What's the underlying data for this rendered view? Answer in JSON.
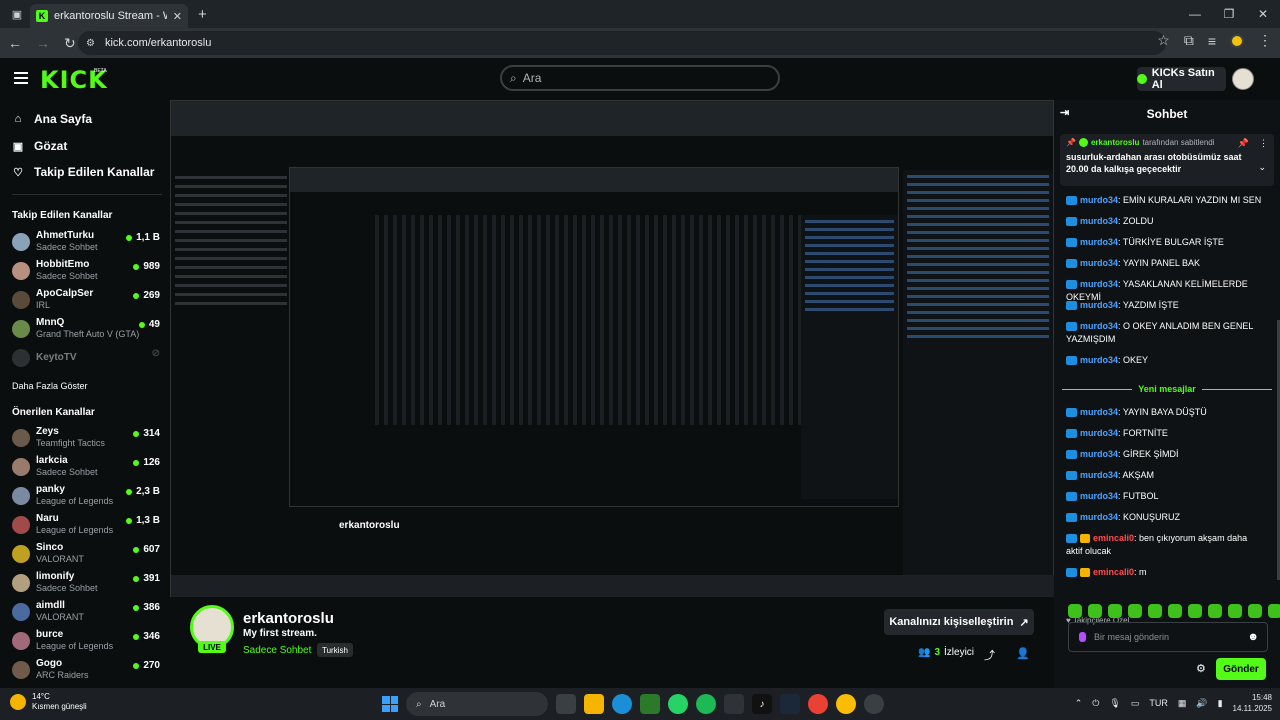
{
  "browser": {
    "tab_title": "erkantoroslu Stream - Watch Liv",
    "url": "kick.com/erkantoroslu"
  },
  "header": {
    "logo": "KICK",
    "beta": "BETA",
    "search_placeholder": "Ara",
    "buy_label": "KICKs Satın Al"
  },
  "sidebar": {
    "nav": [
      {
        "label": "Ana Sayfa",
        "icon": "home-icon"
      },
      {
        "label": "Gözat",
        "icon": "browse-icon"
      },
      {
        "label": "Takip Edilen Kanallar",
        "icon": "heart-icon"
      }
    ],
    "followed_heading": "Takip Edilen Kanallar",
    "followed": [
      {
        "name": "AhmetTurku",
        "category": "Sadece Sohbet",
        "viewers": "1,1 B",
        "color": "#8aa2b8"
      },
      {
        "name": "HobbitEmo",
        "category": "Sadece Sohbet",
        "viewers": "989",
        "color": "#b89080"
      },
      {
        "name": "ApoCalpSer",
        "category": "IRL",
        "viewers": "269",
        "color": "#5a4a3a"
      },
      {
        "name": "MnnQ",
        "category": "Grand Theft Auto V (GTA)",
        "viewers": "49",
        "color": "#6a8a4a"
      },
      {
        "name": "KeytoTV",
        "category": "",
        "viewers": "",
        "color": "#555a60"
      }
    ],
    "show_more": "Daha Fazla Göster",
    "recommended_heading": "Önerilen Kanallar",
    "recommended": [
      {
        "name": "Zeys",
        "category": "Teamfight Tactics",
        "viewers": "314",
        "color": "#6a5a4a"
      },
      {
        "name": "larkcia",
        "category": "Sadece Sohbet",
        "viewers": "126",
        "color": "#9a7a6a"
      },
      {
        "name": "panky",
        "category": "League of Legends",
        "viewers": "2,3 B",
        "color": "#7a8aa0"
      },
      {
        "name": "Naru",
        "category": "League of Legends",
        "viewers": "1,3 B",
        "color": "#a04a4a"
      },
      {
        "name": "Sinco",
        "category": "VALORANT",
        "viewers": "607",
        "color": "#c0a020"
      },
      {
        "name": "limonify",
        "category": "Sadece Sohbet",
        "viewers": "391",
        "color": "#b0a080"
      },
      {
        "name": "aimdll",
        "category": "VALORANT",
        "viewers": "386",
        "color": "#4a6aa0"
      },
      {
        "name": "burce",
        "category": "League of Legends",
        "viewers": "346",
        "color": "#a06a7a"
      },
      {
        "name": "Gogo",
        "category": "ARC Raiders",
        "viewers": "270",
        "color": "#705a4a"
      }
    ]
  },
  "stream": {
    "channel": "erkantoroslu",
    "title": "My first stream.",
    "category": "Sadece Sohbet",
    "tag": "Turkish",
    "live": "LIVE",
    "customize_label": "Kanalınızı kişiselleştirin",
    "viewer_count": "3",
    "viewer_label": "İzleyici",
    "nested_channel": "erkantoroslu"
  },
  "chat": {
    "title": "Sohbet",
    "pinned_by_user": "erkantoroslu",
    "pinned_by_text": "tarafından sabitlendi",
    "pinned_message": "susurluk-ardahan arası otobüsümüz saat 20.00 da kalkışa geçecektir",
    "messages_before": [
      {
        "user": "murdo34",
        "text": ": EMİN KURALARI YAZDIN MI SEN"
      },
      {
        "user": "murdo34",
        "text": ": ZOLDU"
      },
      {
        "user": "murdo34",
        "text": ": TÜRKİYE BULGAR İŞTE"
      },
      {
        "user": "murdo34",
        "text": ": YAYIN PANEL BAK"
      },
      {
        "user": "murdo34",
        "text": ": YASAKLANAN KELİMELERDE OKEYMİ"
      },
      {
        "user": "murdo34",
        "text": ": YAZDIM İŞTE"
      },
      {
        "user": "murdo34",
        "text": ": O OKEY ANLADIM BEN GENEL YAZMIŞDIM"
      },
      {
        "user": "murdo34",
        "text": ": OKEY"
      }
    ],
    "new_messages": "Yeni mesajlar",
    "messages_after": [
      {
        "user": "murdo34",
        "text": ": YAYIN BAYA DÜŞTÜ"
      },
      {
        "user": "murdo34",
        "text": ": FORTNİTE"
      },
      {
        "user": "murdo34",
        "text": ": GİREK ŞİMDİ"
      },
      {
        "user": "murdo34",
        "text": ": AKŞAM"
      },
      {
        "user": "murdo34",
        "text": ": FUTBOL"
      },
      {
        "user": "murdo34",
        "text": ": KONUŞURUZ"
      },
      {
        "user": "emincali0",
        "text": ": ben çıkıyorum akşam daha aktif olucak"
      },
      {
        "user": "emincali0",
        "text": ": m"
      }
    ],
    "emotes_heading": "Takipçilere Özel",
    "input_placeholder": "Bir mesaj gönderin",
    "send_label": "Gönder"
  },
  "taskbar": {
    "temp": "14°C",
    "weather": "Kısmen güneşli",
    "search": "Ara",
    "lang": "TUR",
    "time": "15:48",
    "date": "14.11.2025"
  },
  "colors": {
    "accent": "#53fc18",
    "user_blue": "#4aa3ff",
    "user_red": "#ff4d4d"
  }
}
